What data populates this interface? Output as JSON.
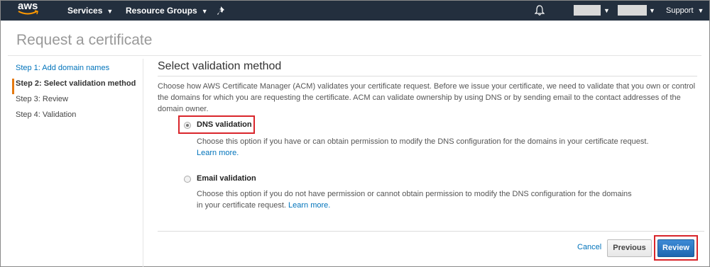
{
  "nav": {
    "logo": "aws",
    "services": "Services",
    "resource_groups": "Resource Groups",
    "support": "Support",
    "icons": [
      "aws-logo",
      "pin-icon",
      "bell-icon"
    ]
  },
  "page": {
    "title": "Request a certificate"
  },
  "steps": [
    {
      "label": "Step 1: Add domain names",
      "state": "link"
    },
    {
      "label": "Step 2: Select validation method",
      "state": "active"
    },
    {
      "label": "Step 3: Review",
      "state": "default"
    },
    {
      "label": "Step 4: Validation",
      "state": "default"
    }
  ],
  "main": {
    "section_title": "Select validation method",
    "intro": "Choose how AWS Certificate Manager (ACM) validates your certificate request. Before we issue your certificate, we need to validate that you own or control the domains for which you are requesting the certificate. ACM can validate ownership by using DNS or by sending email to the contact addresses of the domain owner.",
    "dns": {
      "label": "DNS validation",
      "selected": true,
      "desc": "Choose this option if you have or can obtain permission to modify the DNS configuration for the domains in your certificate request.",
      "learn_more": "Learn more."
    },
    "email": {
      "label": "Email validation",
      "selected": false,
      "desc": "Choose this option if you do not have permission or cannot obtain permission to modify the DNS configuration for the domains in your certificate request.",
      "learn_more": "Learn more."
    }
  },
  "footer": {
    "cancel": "Cancel",
    "previous": "Previous",
    "review": "Review"
  },
  "colors": {
    "nav_bg": "#232f3e",
    "link": "#0073bb",
    "active_step_accent": "#e47911",
    "primary_button": "#2a75c2",
    "highlight": "#d9252b"
  }
}
